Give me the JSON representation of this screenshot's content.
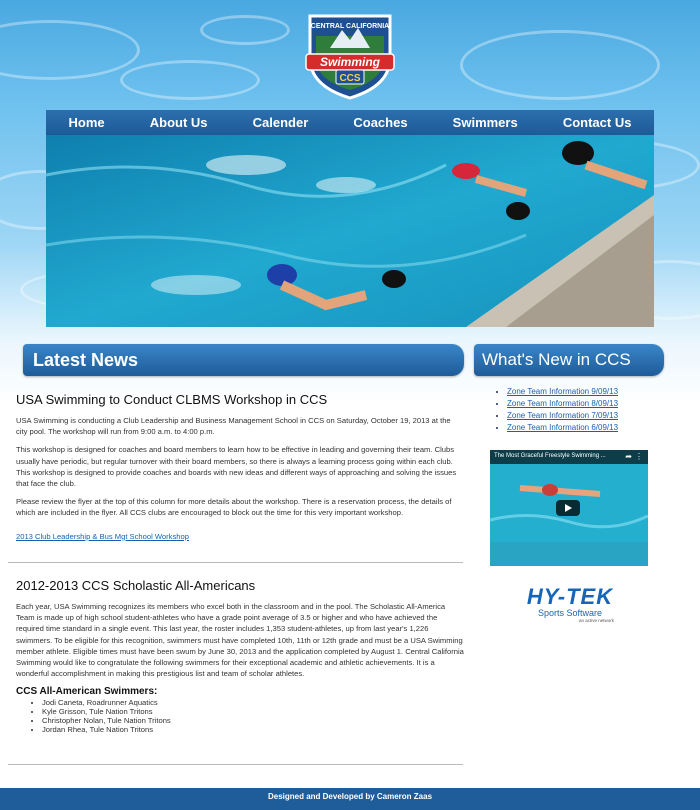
{
  "logo": {
    "top_text": "CENTRAL CALIFORNIA",
    "main_text": "Swimming",
    "badge_text": "CCS"
  },
  "nav": {
    "items": [
      "Home",
      "About Us",
      "Calender",
      "Coaches",
      "Swimmers",
      "Contact Us"
    ]
  },
  "latest_news": {
    "title": "Latest News",
    "articles": [
      {
        "title": "USA Swimming to Conduct CLBMS Workshop in CCS",
        "paragraphs": [
          "USA Swimming is conducting a Club Leadership and Business Management School in CCS on Saturday, October 19, 2013 at the city pool. The workshop will run from 9:00 a.m. to 4:00 p.m.",
          "This workshop is designed for coaches and board members to learn how to be effective in leading and governing their team. Clubs usually have periodic, but regular turnover with their board members, so there is always a learning process going within each club. This workshop is designed to provide coaches and boards with new ideas and different ways of approaching and solving the issues that face the club.",
          "Please review the flyer at the top of this column for more details about the workshop. There is a reservation process, the details of which are included in the flyer. All CCS clubs are encouraged to block out the time for this very important workshop."
        ],
        "link": "2013 Club Leadership & Bus Mgt School Workshop"
      },
      {
        "title": "2012-2013 CCS Scholastic All-Americans",
        "paragraphs": [
          "Each year, USA Swimming recognizes its members who excel both in the classroom and in the pool. The Scholastic All-America Team is made up of high school student-athletes who have a grade point average of 3.5 or higher and who have achieved the required time standard in a single event. This last year, the roster includes 1,353 student-athletes, up from last year's 1,226 swimmers. To be eligible for this recognition, swimmers must have completed 10th, 11th or 12th grade and must be a USA Swimming member athlete. Eligible times must have been swum by June 30, 2013 and the application completed by August 1. Central California Swimming would like to congratulate the following swimmers for their exceptional academic and athletic achievements. It is a wonderful accomplishment in making this prestigious list and team of scholar athletes."
        ],
        "subheading": "CCS All-American Swimmers:",
        "swimmers": [
          "Jodi Caneta, Roadrunner Aquatics",
          "Kyle Grisson, Tule Nation Tritons",
          "Christopher Nolan, Tule Nation Tritons",
          "Jordan Rhea, Tule Nation Tritons"
        ]
      }
    ]
  },
  "whats_new": {
    "title": "What's New in CCS",
    "links": [
      "Zone Team Information 9/09/13",
      "Zone Team Information 8/09/13",
      "Zone Team Information 7/09/13",
      "Zone Team Information 6/09/13"
    ]
  },
  "video": {
    "title": "The Most Graceful Freestyle Swimming ..."
  },
  "hytek": {
    "brand": "HY-TEK",
    "subtitle": "Sports Software",
    "tagline": "an active network"
  },
  "footer": {
    "text": "Designed and Developed by Cameron Zaas"
  },
  "colors": {
    "nav_blue": "#1d5a98",
    "link_blue": "#1a5fb4"
  }
}
